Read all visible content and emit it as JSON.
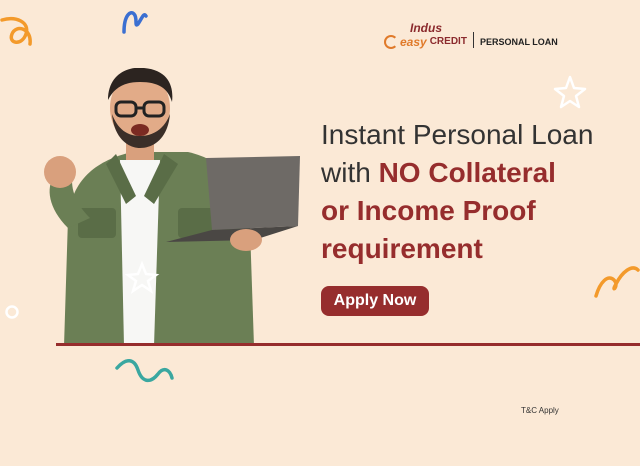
{
  "brand": {
    "logo_top": "Indus",
    "logo_easy": "easy",
    "logo_credit": "CREDIT",
    "product": "PERSONAL LOAN"
  },
  "headline": {
    "line1": "Instant Personal Loan",
    "line2_prefix": "with ",
    "line2_highlight": "NO Collateral",
    "line3": "or Income Proof",
    "line4": "requirement"
  },
  "cta": {
    "label": "Apply Now"
  },
  "footer": {
    "tnc": "T&C Apply"
  },
  "colors": {
    "background": "#fbe9d6",
    "accent": "#962d2d",
    "orange": "#f39a2b",
    "blue": "#3b6fd1",
    "teal": "#3aa7a0"
  },
  "icons": [
    "squiggle-icon",
    "star-outline-icon",
    "ring-icon"
  ],
  "illustration": "man-with-laptop-celebrating"
}
